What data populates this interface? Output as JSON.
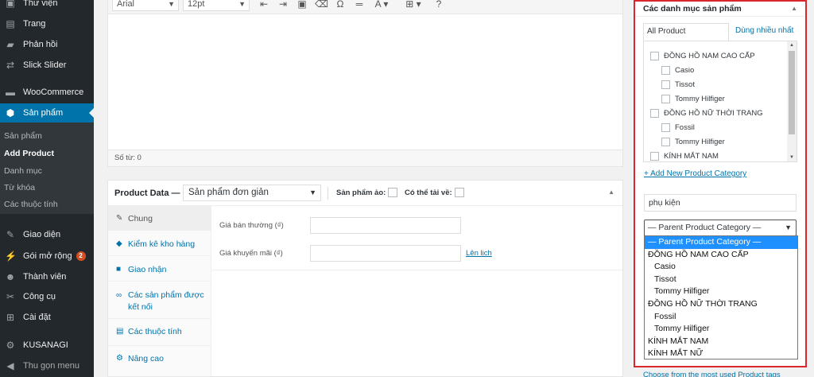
{
  "sidebar": {
    "items": [
      {
        "label": "Thư viện",
        "icon": "media-icon",
        "glyph": "▣"
      },
      {
        "label": "Trang",
        "icon": "page-icon",
        "glyph": "▤"
      },
      {
        "label": "Phản hồi",
        "icon": "comment-icon",
        "glyph": "▰"
      },
      {
        "label": "Slick Slider",
        "icon": "slider-icon",
        "glyph": "⇄"
      },
      {
        "label": "WooCommerce",
        "icon": "woocommerce-icon",
        "glyph": "▬"
      },
      {
        "label": "Sản phẩm",
        "icon": "product-icon",
        "glyph": "⬢"
      },
      {
        "label": "Giao diện",
        "icon": "appearance-icon",
        "glyph": "✎"
      },
      {
        "label": "Gói mở rộng",
        "icon": "plugins-icon",
        "glyph": "⚡"
      },
      {
        "label": "Thành viên",
        "icon": "users-icon",
        "glyph": "☻"
      },
      {
        "label": "Công cụ",
        "icon": "tools-icon",
        "glyph": "✂"
      },
      {
        "label": "Cài đặt",
        "icon": "settings-icon",
        "glyph": "⊞"
      },
      {
        "label": "KUSANAGI",
        "icon": "kusanagi-icon",
        "glyph": "⚙"
      },
      {
        "label": "Thu gọn menu",
        "icon": "collapse-icon",
        "glyph": "◀"
      }
    ],
    "plugin_badge": "2",
    "submenu": [
      "Sản phẩm",
      "Add Product",
      "Danh mục",
      "Từ khóa",
      "Các thuộc tính"
    ]
  },
  "editor": {
    "font_family": "Arial",
    "font_size": "12pt",
    "word_count": "Số từ: 0",
    "toolbar_icons": [
      "outdent-icon",
      "indent-icon",
      "paste-icon",
      "clear-format-icon",
      "omega-icon",
      "hr-icon",
      "text-color-icon",
      "table-icon",
      "help-icon"
    ]
  },
  "product_data": {
    "title": "Product Data —",
    "type": "Sản phẩm đơn giản",
    "virtual_label": "Sản phẩm ảo:",
    "downloadable_label": "Có thể tải về:",
    "tabs": [
      {
        "label": "Chung",
        "icon": "wrench-icon",
        "glyph": "✎"
      },
      {
        "label": "Kiểm kê kho hàng",
        "icon": "inventory-icon",
        "glyph": "◆"
      },
      {
        "label": "Giao nhận",
        "icon": "shipping-icon",
        "glyph": "■"
      },
      {
        "label": "Các sản phẩm được kết nối",
        "icon": "link-icon",
        "glyph": "∞"
      },
      {
        "label": "Các thuộc tính",
        "icon": "attributes-icon",
        "glyph": "▤"
      },
      {
        "label": "Nâng cao",
        "icon": "gear-icon",
        "glyph": "⚙"
      }
    ],
    "regular_price_label": "Giá bán thường (₫)",
    "sale_price_label": "Giá khuyến mãi (₫)",
    "schedule_link": "Lên lịch"
  },
  "categories": {
    "title": "Các danh mục sản phẩm",
    "tab_all": "All Product Categories",
    "tab_most_used": "Dùng nhiều nhất",
    "list": [
      {
        "label": "ĐỒNG HỒ NAM CAO CẤP",
        "level": 0
      },
      {
        "label": "Casio",
        "level": 1
      },
      {
        "label": "Tissot",
        "level": 1
      },
      {
        "label": "Tommy Hilfiger",
        "level": 1
      },
      {
        "label": "ĐỒNG HỒ NỮ THỜI TRANG",
        "level": 0
      },
      {
        "label": "Fossil",
        "level": 1
      },
      {
        "label": "Tommy Hilfiger",
        "level": 1
      },
      {
        "label": "KÍNH MẮT NAM",
        "level": 0
      }
    ],
    "add_new_link": "+ Add New Product Category",
    "new_category_value": "phụ kiện",
    "parent_select_value": "— Parent Product Category —",
    "dropdown_options": [
      {
        "label": "— Parent Product Category —",
        "level": 0,
        "selected": true
      },
      {
        "label": "ĐỒNG HỒ NAM CAO CẤP",
        "level": 0
      },
      {
        "label": "Casio",
        "level": 1
      },
      {
        "label": "Tissot",
        "level": 1
      },
      {
        "label": "Tommy Hilfiger",
        "level": 1
      },
      {
        "label": "ĐỒNG HỒ NỮ THỜI TRANG",
        "level": 0
      },
      {
        "label": "Fossil",
        "level": 1
      },
      {
        "label": "Tommy Hilfiger",
        "level": 1
      },
      {
        "label": "KÍNH MẮT NAM",
        "level": 0
      },
      {
        "label": "KÍNH MẮT NỮ",
        "level": 0
      }
    ],
    "tags_link": "Choose from the most used Product tags"
  },
  "colors": {
    "accent": "#0073aa",
    "highlight_border": "#d9272d",
    "dropdown_selected": "#1e90ff",
    "sidebar_bg": "#23282d"
  }
}
